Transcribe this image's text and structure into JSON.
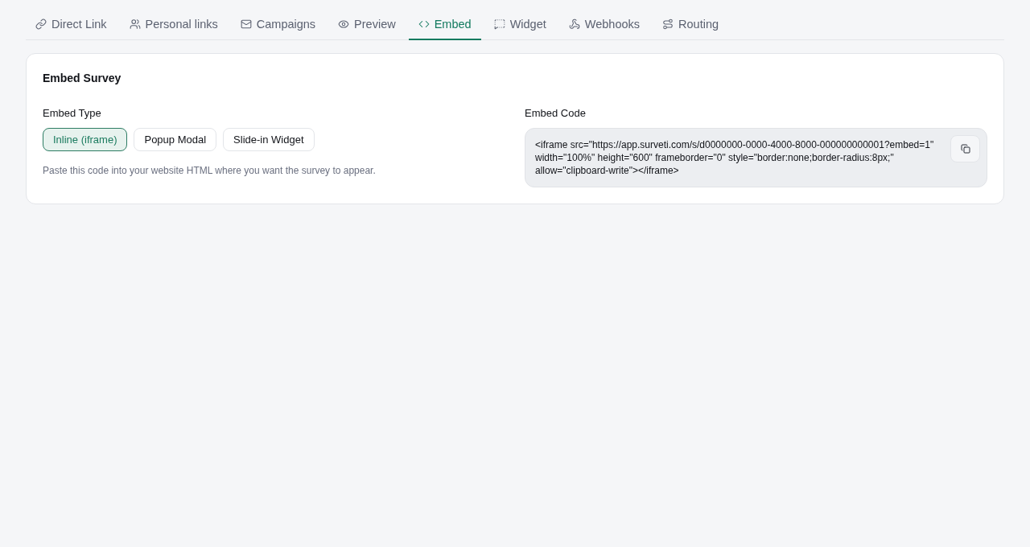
{
  "tabs": [
    {
      "label": "Direct Link",
      "selected": false
    },
    {
      "label": "Personal links",
      "selected": false
    },
    {
      "label": "Campaigns",
      "selected": false
    },
    {
      "label": "Preview",
      "selected": false
    },
    {
      "label": "Embed",
      "selected": true
    },
    {
      "label": "Widget",
      "selected": false
    },
    {
      "label": "Webhooks",
      "selected": false
    },
    {
      "label": "Routing",
      "selected": false
    }
  ],
  "card": {
    "title": "Embed Survey",
    "embed_type": {
      "label": "Embed Type",
      "options": [
        {
          "label": "Inline (iframe)",
          "selected": true
        },
        {
          "label": "Popup Modal",
          "selected": false
        },
        {
          "label": "Slide-in Widget",
          "selected": false
        }
      ],
      "hint": "Paste this code into your website HTML where you want the survey to appear."
    },
    "embed_code": {
      "label": "Embed Code",
      "code": "<iframe src=\"https://app.surveti.com/s/d0000000-0000-4000-8000-000000000001?embed=1\" width=\"100%\" height=\"600\" frameborder=\"0\" style=\"border:none;border-radius:8px;\" allow=\"clipboard-write\"></iframe>"
    }
  }
}
